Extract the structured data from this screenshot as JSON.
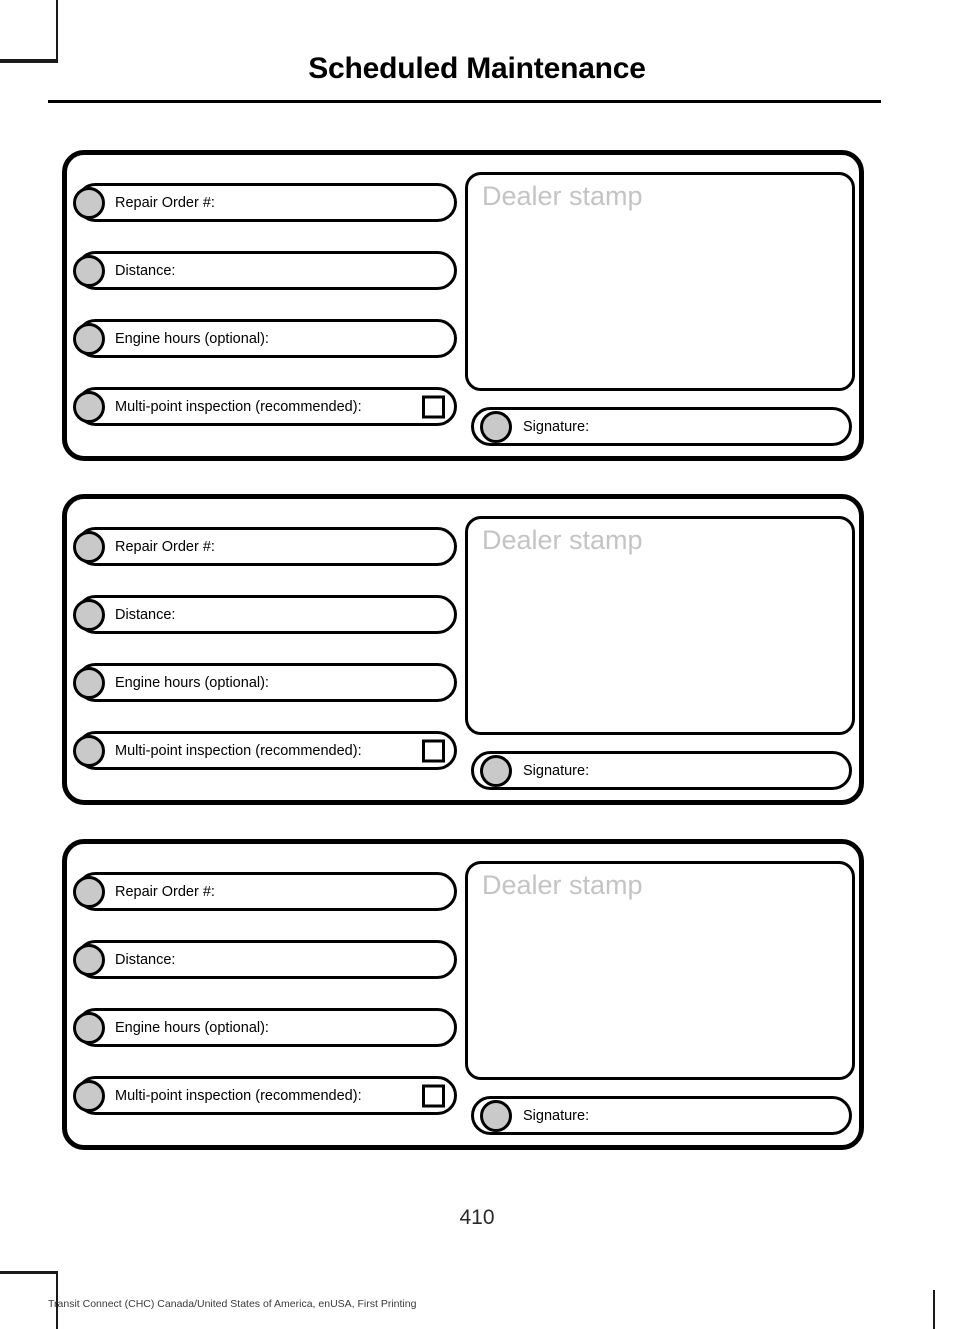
{
  "document": {
    "title": "Scheduled Maintenance",
    "page_number": "410",
    "footer_note": "Transit Connect (CHC) Canada/United States of America, enUSA, First Printing"
  },
  "colors": {
    "ink": "#000000",
    "dot_fill": "#c9c9c9",
    "stamp_placeholder": "#c4c4c4",
    "page_background": "#ffffff"
  },
  "record_block_labels": {
    "repair_order": "Repair Order #:",
    "distance": "Distance:",
    "engine_hours": "Engine hours (optional):",
    "multi_point": "Multi-point inspection (recommended):",
    "dealer_stamp": "Dealer stamp",
    "signature": "Signature:"
  },
  "records": [
    {
      "fields": [
        {
          "label": "Repair Order #:",
          "value": "",
          "has_checkbox": false
        },
        {
          "label": "Distance:",
          "value": "",
          "has_checkbox": false
        },
        {
          "label": "Engine hours (optional):",
          "value": "",
          "has_checkbox": false
        },
        {
          "label": "Multi-point inspection (recommended):",
          "value": "",
          "has_checkbox": true
        }
      ],
      "dealer_stamp": {
        "placeholder": "Dealer stamp",
        "value": ""
      },
      "signature": {
        "label": "Signature:",
        "value": ""
      }
    },
    {
      "fields": [
        {
          "label": "Repair Order #:",
          "value": "",
          "has_checkbox": false
        },
        {
          "label": "Distance:",
          "value": "",
          "has_checkbox": false
        },
        {
          "label": "Engine hours (optional):",
          "value": "",
          "has_checkbox": false
        },
        {
          "label": "Multi-point inspection (recommended):",
          "value": "",
          "has_checkbox": true
        }
      ],
      "dealer_stamp": {
        "placeholder": "Dealer stamp",
        "value": ""
      },
      "signature": {
        "label": "Signature:",
        "value": ""
      }
    },
    {
      "fields": [
        {
          "label": "Repair Order #:",
          "value": "",
          "has_checkbox": false
        },
        {
          "label": "Distance:",
          "value": "",
          "has_checkbox": false
        },
        {
          "label": "Engine hours (optional):",
          "value": "",
          "has_checkbox": false
        },
        {
          "label": "Multi-point inspection (recommended):",
          "value": "",
          "has_checkbox": true
        }
      ],
      "dealer_stamp": {
        "placeholder": "Dealer stamp",
        "value": ""
      },
      "signature": {
        "label": "Signature:",
        "value": ""
      }
    }
  ]
}
